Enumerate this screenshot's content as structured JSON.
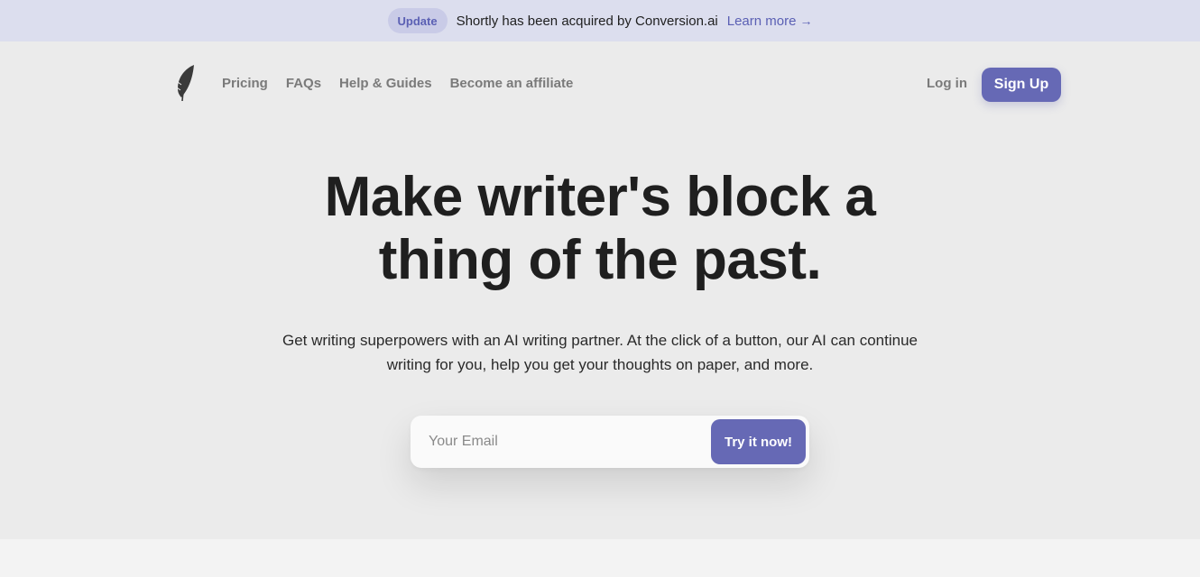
{
  "banner": {
    "badge": "Update",
    "text": "Shortly has been acquired by Conversion.ai",
    "link": "Learn more",
    "link_arrow_icon": "arrow-right-icon"
  },
  "nav": {
    "logo_icon": "feather-icon",
    "links": [
      {
        "label": "Pricing"
      },
      {
        "label": "FAQs"
      },
      {
        "label": "Help & Guides"
      },
      {
        "label": "Become an affiliate"
      }
    ],
    "login": "Log in",
    "signup": "Sign Up"
  },
  "hero": {
    "title_line1": "Make writer's block a",
    "title_line2": "thing of the past.",
    "subtitle_line1": "Get writing superpowers with an AI writing partner. At the click of a button, our AI can continue",
    "subtitle_line2": "writing for you, help you get your thoughts on paper, and more."
  },
  "form": {
    "email_placeholder": "Your Email",
    "email_value": "",
    "submit": "Try it now!"
  },
  "colors": {
    "accent": "#6669b5",
    "banner_bg": "#dcdeee",
    "page_bg": "#ebebeb"
  }
}
